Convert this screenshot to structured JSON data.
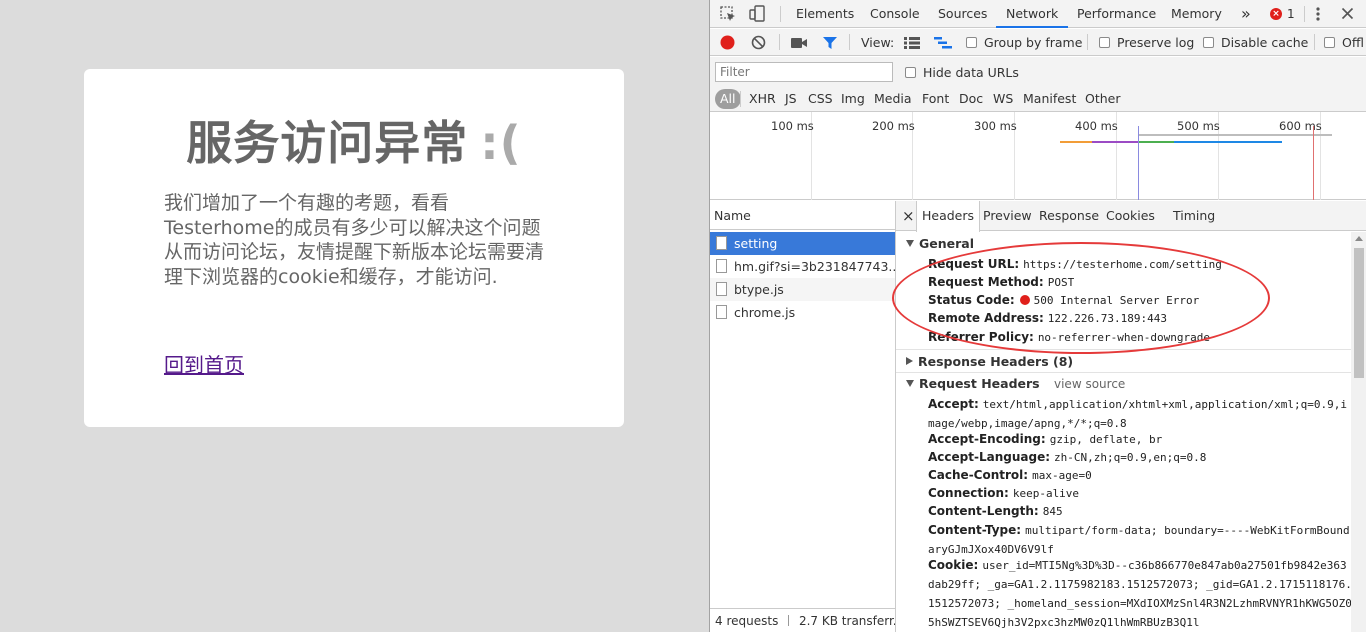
{
  "page": {
    "title": "服务访问异常",
    "title_face": ":(",
    "body": "我们增加了一个有趣的考题，看看Testerhome的成员有多少可以解决这个问题从而访问论坛，友情提醒下新版本论坛需要清理下浏览器的cookie和缓存，才能访问.",
    "link": "回到首页"
  },
  "devtools": {
    "tabs": [
      "Elements",
      "Console",
      "Sources",
      "Network",
      "Performance",
      "Memory"
    ],
    "active_tab": "Network",
    "more_tabs": "»",
    "error_count": "1",
    "toolbar": {
      "view_label": "View:",
      "group_by_frame": "Group by frame",
      "preserve_log": "Preserve log",
      "disable_cache": "Disable cache",
      "offline": "Offl"
    },
    "filter": {
      "placeholder": "Filter",
      "hide_data_urls": "Hide data URLs"
    },
    "types": [
      "All",
      "XHR",
      "JS",
      "CSS",
      "Img",
      "Media",
      "Font",
      "Doc",
      "WS",
      "Manifest",
      "Other"
    ],
    "timeline_ticks": [
      "100 ms",
      "200 ms",
      "300 ms",
      "400 ms",
      "500 ms",
      "600 ms"
    ],
    "name_header": "Name",
    "requests": [
      {
        "name": "setting",
        "selected": true
      },
      {
        "name": "hm.gif?si=3b231847743..."
      },
      {
        "name": "btype.js"
      },
      {
        "name": "chrome.js"
      }
    ],
    "status_bar": {
      "requests": "4 requests",
      "transferred": "2.7 KB transferr..."
    },
    "detail_tabs": [
      "Headers",
      "Preview",
      "Response",
      "Cookies",
      "Timing"
    ],
    "active_detail_tab": "Headers",
    "close_symbol": "×",
    "general": {
      "title": "General",
      "request_url_k": "Request URL:",
      "request_url_v": "https://testerhome.com/setting",
      "method_k": "Request Method:",
      "method_v": "POST",
      "status_k": "Status Code:",
      "status_v": "500 Internal Server Error",
      "remote_k": "Remote Address:",
      "remote_v": "122.226.73.189:443",
      "referrer_k": "Referrer Policy:",
      "referrer_v": "no-referrer-when-downgrade"
    },
    "response_headers": {
      "title": "Response Headers (8)"
    },
    "request_headers": {
      "title": "Request Headers",
      "view_source": "view source",
      "accept_k": "Accept:",
      "accept_v": "text/html,application/xhtml+xml,application/xml;q=0.9,image/webp,image/apng,*/*;q=0.8",
      "encoding_k": "Accept-Encoding:",
      "encoding_v": "gzip, deflate, br",
      "language_k": "Accept-Language:",
      "language_v": "zh-CN,zh;q=0.9,en;q=0.8",
      "cache_k": "Cache-Control:",
      "cache_v": "max-age=0",
      "connection_k": "Connection:",
      "connection_v": "keep-alive",
      "length_k": "Content-Length:",
      "length_v": "845",
      "ctype_k": "Content-Type:",
      "ctype_v": "multipart/form-data; boundary=----WebKitFormBoundaryGJmJXox40DV6V9lf",
      "cookie_k": "Cookie:",
      "cookie_v": "user_id=MTI5Ng%3D%3D--c36b866770e847ab0a27501fb9842e363dab29ff; _ga=GA1.2.1175982183.1512572073; _gid=GA1.2.1715118176.1512572073; _homeland_session=MXdIOXMzSnl4R3N2LzhmRVNYR1hKWG5OZ05hSWZTSEV6Qjh3V2pxc3hzMW0zQ1lhWmRBUzB3Q1l"
    },
    "colors": {
      "accent": "#1a73e8",
      "selected_row": "#3879d9",
      "record": "#e0201b",
      "annotation": "#e53a3a"
    }
  }
}
